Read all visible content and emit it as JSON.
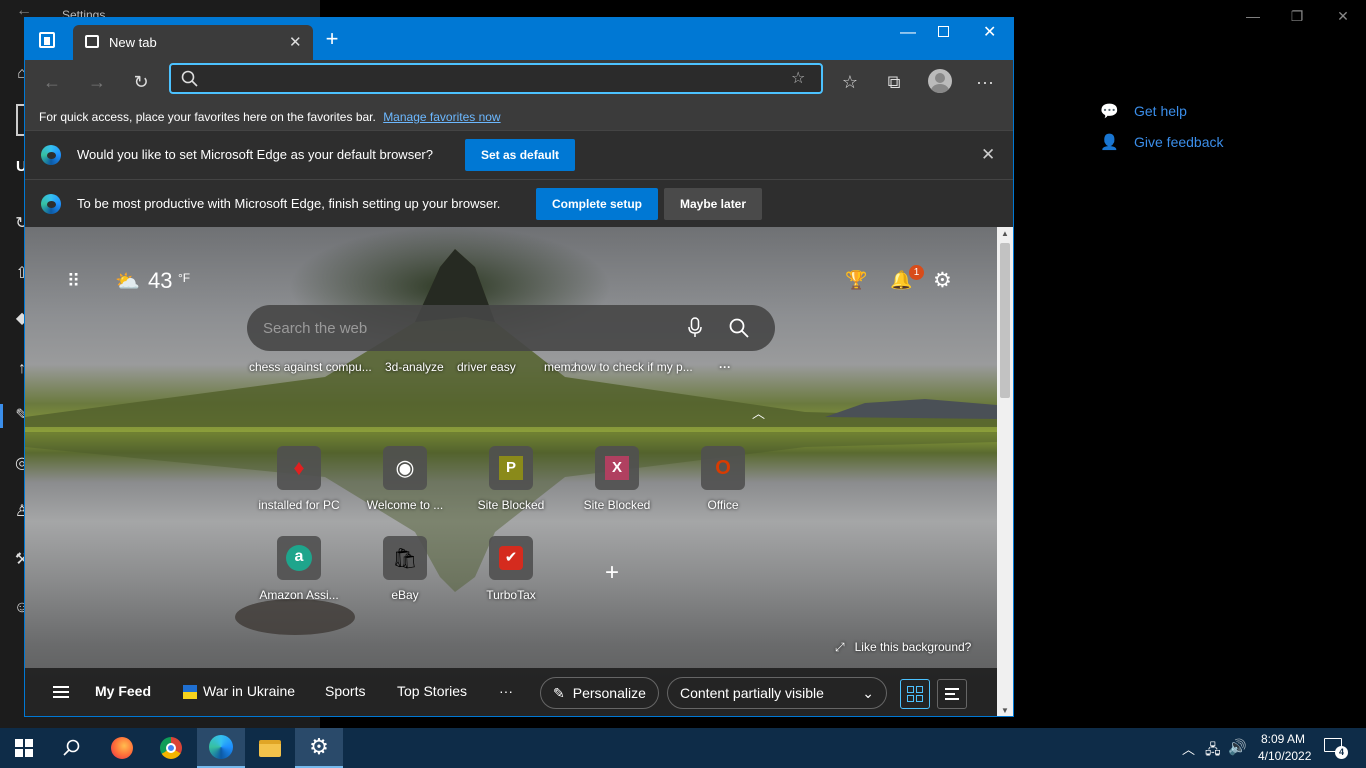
{
  "settings_window": {
    "title": "Settings",
    "help": [
      {
        "label": "Get help"
      },
      {
        "label": "Give feedback"
      }
    ],
    "partial_label": "U"
  },
  "edge": {
    "tab_title": "New tab",
    "address_value": "",
    "favorites_bar": {
      "text": "For quick access, place your favorites here on the favorites bar.",
      "link": "Manage favorites now"
    },
    "default_bar": {
      "message": "Would you like to set Microsoft Edge as your default browser?",
      "button": "Set as default"
    },
    "setup_bar": {
      "message": "To be most productive with Microsoft Edge, finish setting up your browser.",
      "primary": "Complete setup",
      "secondary": "Maybe later"
    },
    "ntp": {
      "temperature": "43",
      "unit": "°F",
      "notification_count": "1",
      "search_placeholder": "Search the web",
      "recent_searches": [
        "chess against compu...",
        "3d-analyze",
        "driver easy",
        "memz",
        "how to check if my p..."
      ],
      "more": "···",
      "tiles": [
        {
          "label": "installed for PC",
          "glyph": "♦",
          "color": "#e02020"
        },
        {
          "label": "Welcome to ...",
          "glyph": "◉",
          "color": "#1b2838"
        },
        {
          "label": "Site Blocked",
          "glyph": "P",
          "color": "#8a8a1a"
        },
        {
          "label": "Site Blocked",
          "glyph": "X",
          "color": "#b04060"
        },
        {
          "label": "Office",
          "glyph": "O",
          "color": "#d83b01"
        },
        {
          "label": "Amazon Assi...",
          "glyph": "a",
          "color": "#1ea58c"
        },
        {
          "label": "eBay",
          "glyph": "🛍",
          "color": "#444"
        },
        {
          "label": "TurboTax",
          "glyph": "✔",
          "color": "#d52b1e"
        }
      ],
      "like_background": "Like this background?",
      "feed": {
        "my_feed": "My Feed",
        "items": [
          "War in Ukraine",
          "Sports",
          "Top Stories"
        ],
        "more": "···",
        "personalize": "Personalize",
        "content_visibility": "Content partially visible"
      }
    }
  },
  "taskbar": {
    "time": "8:09 AM",
    "date": "4/10/2022",
    "notifications": "4"
  }
}
